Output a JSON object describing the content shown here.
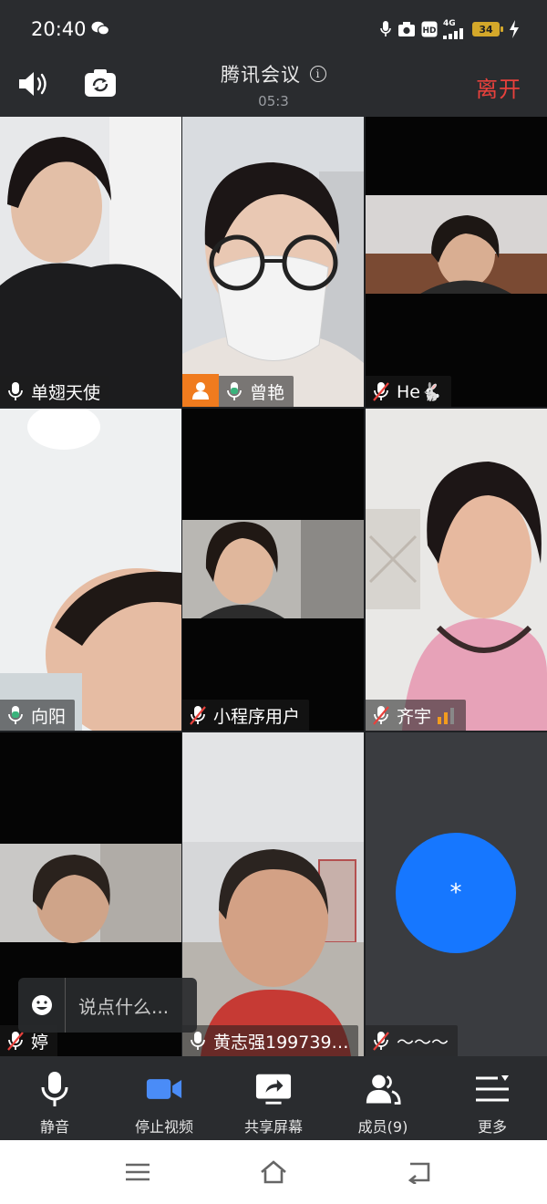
{
  "status_bar": {
    "time": "20:40",
    "network": "4G",
    "battery": "34",
    "icons": [
      "wechat-icon",
      "mic-indicator-icon",
      "camera-indicator-icon",
      "hd-icon",
      "signal-icon",
      "battery-icon",
      "charging-icon"
    ]
  },
  "header": {
    "title": "腾讯会议",
    "timer": "05:3",
    "leave_label": "离开",
    "leave_color": "#e8413c"
  },
  "participants": [
    {
      "name": "单翅天使",
      "mic": "on"
    },
    {
      "name": "曾艳",
      "mic": "speaking",
      "active": true
    },
    {
      "name": "He🐇",
      "mic": "muted"
    },
    {
      "name": "向阳",
      "mic": "speaking"
    },
    {
      "name": "小程序用户",
      "mic": "muted"
    },
    {
      "name": "齐宇",
      "mic": "muted",
      "signal": "weak"
    },
    {
      "name": "婷",
      "mic": "muted"
    },
    {
      "name": "黄志强199739…",
      "mic": "on"
    },
    {
      "name": "～～～",
      "mic": "muted",
      "avatar_text": "*"
    }
  ],
  "chat": {
    "placeholder": "说点什么..."
  },
  "toolbar": {
    "mute_label": "静音",
    "video_label": "停止视频",
    "share_label": "共享屏幕",
    "members_label": "成员(9)",
    "more_label": "更多"
  },
  "colors": {
    "accent_blue": "#1677ff",
    "speaking_green": "#3ab37c",
    "badge_orange": "#f07b1e"
  }
}
